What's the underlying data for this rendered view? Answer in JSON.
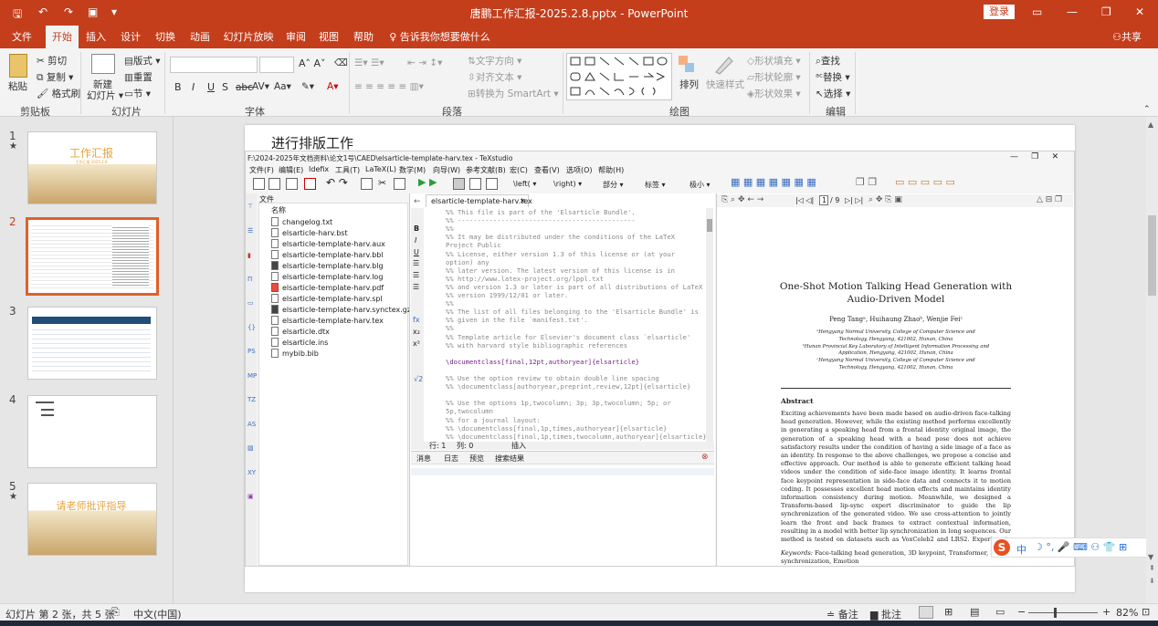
{
  "window": {
    "title": "唐鹏工作汇报-2025.2.8.pptx  -  PowerPoint",
    "login": "登录"
  },
  "tabs": [
    "文件",
    "开始",
    "插入",
    "设计",
    "切换",
    "动画",
    "幻灯片放映",
    "审阅",
    "视图",
    "帮助"
  ],
  "tell_me": "告诉我你想要做什么",
  "share": "共享",
  "clipboard": {
    "paste": "粘贴",
    "cut": "剪切",
    "copy": "复制",
    "format_painter": "格式刷",
    "label": "剪贴板"
  },
  "slides_group": {
    "new_slide": "新建",
    "new_slide2": "幻灯片",
    "layout": "版式",
    "reset": "重置",
    "section": "节",
    "label": "幻灯片"
  },
  "font_group": {
    "label": "字体",
    "buttons": [
      "B",
      "I",
      "U",
      "S",
      "abc",
      "AV",
      "Aa",
      "A"
    ]
  },
  "paragraph_group": {
    "text_direction": "文字方向",
    "align_text": "对齐文本",
    "convert_smartart": "转换为 SmartArt",
    "label": "段落"
  },
  "drawing_group": {
    "arrange": "排列",
    "quick_styles": "快速样式",
    "shape_fill": "形状填充",
    "shape_outline": "形状轮廓",
    "shape_effects": "形状效果",
    "label": "绘图"
  },
  "editing_group": {
    "find": "查找",
    "replace": "替换",
    "select": "选择",
    "label": "编辑"
  },
  "thumbnails": [
    {
      "num": "1",
      "star": true,
      "title": "工作汇报",
      "sub": "工作汇报 2025.2.8"
    },
    {
      "num": "2",
      "star": false
    },
    {
      "num": "3",
      "star": false
    },
    {
      "num": "4",
      "star": false
    },
    {
      "num": "5",
      "star": true,
      "title": "请老师批评指导"
    }
  ],
  "slide": {
    "title": "进行排版工作",
    "texstudio": {
      "title": "F:\\2024-2025年文档资料\\论文1号\\CAED\\elsarticle-template-harv.tex - TeXstudio",
      "menus": [
        "文件(F)",
        "编辑(E)",
        "Idefix",
        "工具(T)",
        "LaTeX(L)",
        "数学(M)",
        "向导(W)",
        "参考文献(B)",
        "宏(C)",
        "查看(V)",
        "选项(O)",
        "帮助(H)"
      ],
      "toolbar_dropdowns": [
        "\\left(",
        "\\right)",
        "部分",
        "标签",
        "极小"
      ],
      "files_header": "文件",
      "name_header": "名称",
      "files": [
        "changelog.txt",
        "elsarticle-harv.bst",
        "elsarticle-template-harv.aux",
        "elsarticle-template-harv.bbl",
        "elsarticle-template-harv.blg",
        "elsarticle-template-harv.log",
        "elsarticle-template-harv.pdf",
        "elsarticle-template-harv.spl",
        "elsarticle-template-harv.synctex.gz",
        "elsarticle-template-harv.tex",
        "elsarticle.dtx",
        "elsarticle.ins",
        "mybib.bib"
      ],
      "editor_tab": "elsarticle-template-harv.tex",
      "code_lines": [
        "%% This file is part of the 'Elsarticle Bundle'.",
        "%% ---------------------------------------------",
        "%%",
        "%% It may be distributed under the conditions of the LaTeX",
        "Project Public",
        "%% License, either version 1.3 of this license or (at your",
        "option) any",
        "%% later version.  The latest version of this license is in",
        "%%    http://www.latex-project.org/lppl.txt",
        "%% and version 1.3 or later is part of all distributions of LaTeX",
        "%% version 1999/12/01 or later.",
        "%%",
        "%% The list of all files belonging to the 'Elsarticle Bundle' is",
        "%% given in the file `manifest.txt'.",
        "%%",
        "%% Template article for Elsevier's document class `elsarticle'",
        "%% with harvard style bibliographic references",
        "",
        "\\documentclass[final,12pt,authoryear]{elsarticle}",
        "",
        "%% Use the option review to obtain double line spacing",
        "%% \\documentclass[authoryear,preprint,review,12pt]{elsarticle}",
        "",
        "%% Use the options 1p,twocolumn; 3p; 3p,twocolumn; 5p; or",
        "5p,twocolumn",
        "%% for a journal layout:",
        "%% \\documentclass[final,1p,times,authoryear]{elsarticle}",
        "%% \\documentclass[final,1p,times,twocolumn,authoryear]{elsarticle}"
      ],
      "status": {
        "line": "行: 1",
        "col": "列: 0",
        "mode": "插入"
      },
      "bottom_tabs": [
        "消息",
        "日志",
        "预览",
        "搜索结果"
      ],
      "pdf_page": "1",
      "pdf_pages": "/ 9",
      "paper": {
        "title1": "One-Shot Motion Talking Head Generation with",
        "title2": "Audio-Driven Model",
        "authors": "Peng Tangᵃ, Huihaung Zhaoᵇ, Wenjie Feiᶜ",
        "aff1": "ᵃHengyang Normal University, College of Computer Science and",
        "aff1b": "Technology, Hengyang, 421002, Hunan, China",
        "aff2": "ᵇHunan Provincial Key Laboratory of Intelligent Information Processing and",
        "aff2b": "Application, Hengyang, 421002, Hunan, China",
        "aff3": "ᶜHengyang Normal University, College of Computer Science and",
        "aff3b": "Technology, Hengyang, 421002, Hunan, China",
        "abstract_head": "Abstract",
        "abstract": "Exciting achievements have been made based on audio-driven face-talking head generation. However, while the existing method performs excellently in generating a speaking head from a frontal identity original image, the generation of a speaking head with a head pose does not achieve satisfactory results under the condition of having a side image of a face as an identity. In response to the above challenges, we propose a concise and effective approach. Our method is able to generate efficient talking head videos under the condition of side-face image identity. It learns frontal face keypoint representation in side-face data and connects it to motion coding. It possesses excellent head motion effects and maintains identity information consistency during motion. Meanwhile, we designed a Transform-based lip-sync expert discriminator to guide the lip synchronization of the generated video. We use cross-attention to jointly learn the front and back frames to extract contextual information, resulting in a model with better lip synchronization in long sequences. Our method is tested on datasets such as VoxCeleb2 and LRS2. Experiments demonstrate the excellent capability of our meth",
        "keywords_label": "Keywords:",
        "keywords": "Face-talking head generation, 3D keypoint, Transformer, Lip-",
        "keywords2": "synchronization, Emotion"
      }
    }
  },
  "statusbar": {
    "slide_info": "幻灯片 第 2 张，共 5 张",
    "language": "中文(中国)",
    "notes": "备注",
    "comments": "批注",
    "zoom": "82%"
  },
  "ime": {
    "lang": "中"
  },
  "colors": {
    "accent": "#c43e1c",
    "selection": "#e0602c"
  }
}
